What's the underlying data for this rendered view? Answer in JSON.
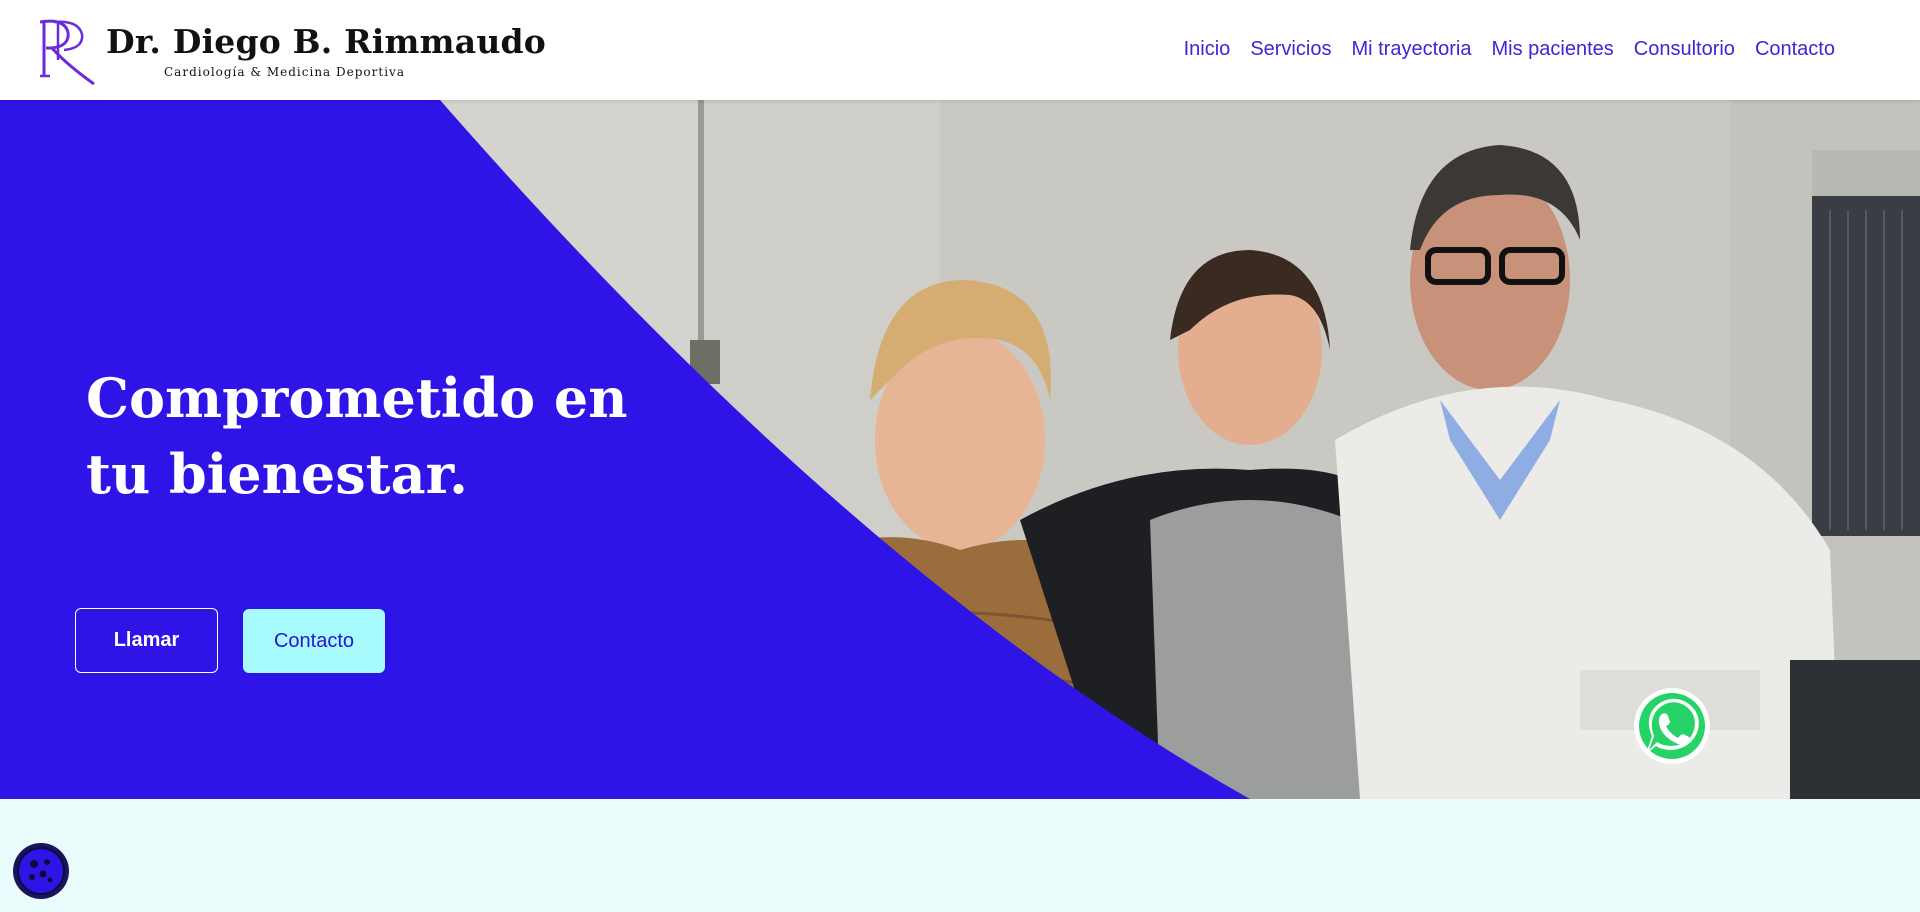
{
  "brand": {
    "name": "Dr. Diego B. Rimmaudo",
    "subtitle": "Cardiología & Medicina Deportiva",
    "monogram": "DR"
  },
  "nav": {
    "items": [
      "Inicio",
      "Servicios",
      "Mi trayectoria",
      "Mis pacientes",
      "Consultorio",
      "Contacto"
    ]
  },
  "hero": {
    "title_line1": "Comprometido en",
    "title_line2": "tu bienestar.",
    "call_label": "Llamar",
    "contact_label": "Contacto"
  },
  "colors": {
    "brand_blue": "#2f14e8",
    "nav_text": "#3f24d9",
    "accent_cyan": "#a8fbfd",
    "section_bg": "#e9fbfb",
    "whatsapp_green": "#25d366"
  },
  "icons": {
    "whatsapp": "whatsapp-icon",
    "cookie": "cookie-icon"
  }
}
